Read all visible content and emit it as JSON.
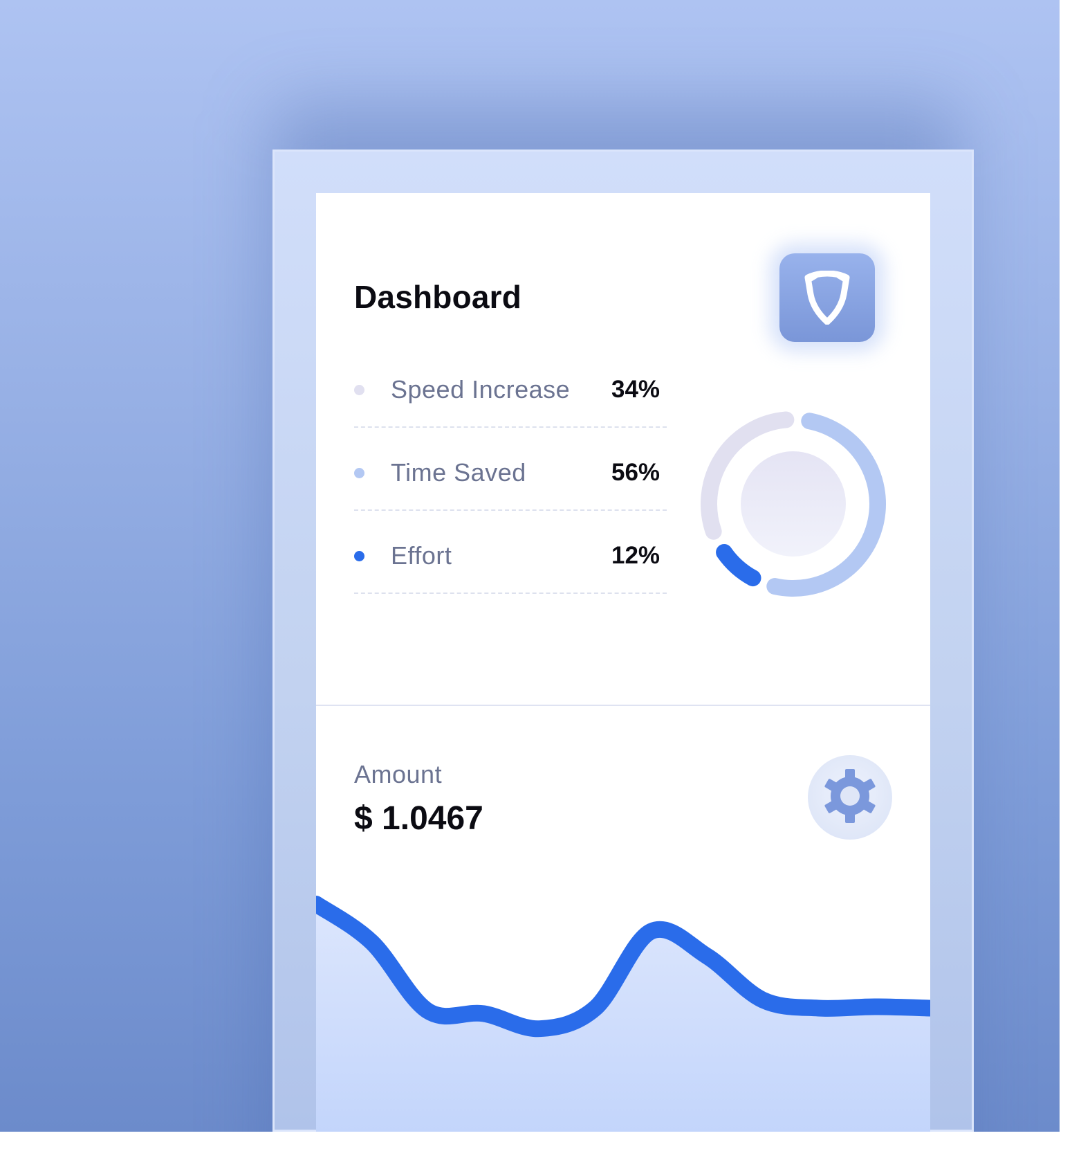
{
  "header": {
    "title": "Dashboard",
    "badge_icon": "shield-icon"
  },
  "stats": [
    {
      "label": "Speed Increase",
      "value": "34%",
      "color": "#e1e0f0"
    },
    {
      "label": "Time Saved",
      "value": "56%",
      "color": "#b3c8f3"
    },
    {
      "label": "Effort",
      "value": "12%",
      "color": "#2a6cea"
    }
  ],
  "amount": {
    "label": "Amount",
    "value": "$ 1.0467",
    "settings_icon": "gear-icon"
  },
  "colors": {
    "accent": "#2a6cea",
    "light_accent": "#b3c8f3",
    "muted": "#e1e0f0",
    "text_primary": "#0b0b12",
    "text_secondary": "#6b7391"
  },
  "chart_data": [
    {
      "type": "pie",
      "variant": "donut",
      "categories": [
        "Speed Increase",
        "Time Saved",
        "Effort"
      ],
      "values": [
        34,
        56,
        12
      ]
    },
    {
      "type": "area",
      "values": [
        1.0,
        0.72,
        0.22,
        0.2,
        0.09,
        0.24,
        0.8,
        0.62,
        0.3,
        0.24,
        0.25,
        0.24
      ]
    }
  ]
}
